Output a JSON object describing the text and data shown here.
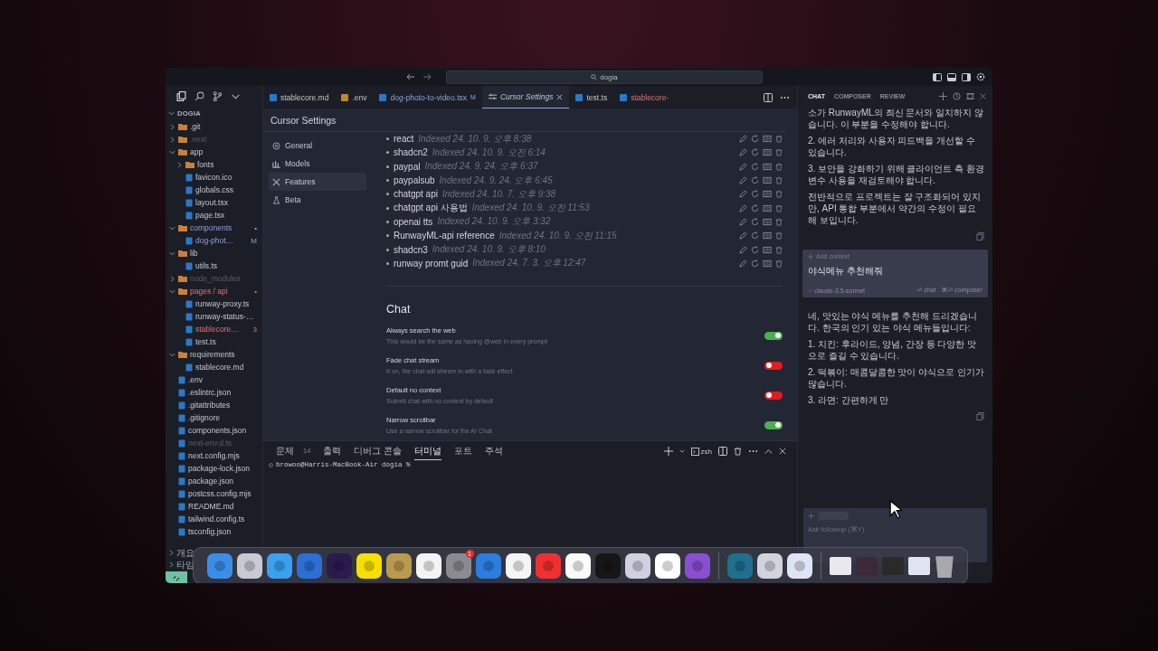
{
  "window": {
    "search": "dogia"
  },
  "explorer": {
    "root": "DOGIA",
    "tree": [
      {
        "name": ".git",
        "kind": "folder",
        "expanded": false,
        "ignored": false,
        "modified": false,
        "error": false
      },
      {
        "name": ".next",
        "kind": "folder",
        "expanded": false,
        "ignored": true,
        "modified": false,
        "error": false
      },
      {
        "name": "app",
        "kind": "folder",
        "expanded": true,
        "ignored": false,
        "modified": false,
        "error": false,
        "children": [
          {
            "name": "fonts",
            "kind": "folder",
            "expanded": false,
            "ignored": false,
            "modified": false,
            "error": false
          },
          {
            "name": "favicon.ico",
            "kind": "file",
            "ignored": false,
            "modified": false,
            "error": false
          },
          {
            "name": "globals.css",
            "kind": "file",
            "ignored": false,
            "modified": false,
            "error": false
          },
          {
            "name": "layout.tsx",
            "kind": "file",
            "ignored": false,
            "modified": false,
            "error": false
          },
          {
            "name": "page.tsx",
            "kind": "file",
            "ignored": false,
            "modified": false,
            "error": false
          }
        ]
      },
      {
        "name": "components",
        "kind": "folder",
        "expanded": true,
        "ignored": false,
        "modified": true,
        "error": false,
        "badge": "•",
        "children": [
          {
            "name": "dog-phot…",
            "kind": "file",
            "ignored": false,
            "modified": true,
            "error": false,
            "badge": "M"
          }
        ]
      },
      {
        "name": "lib",
        "kind": "folder",
        "expanded": true,
        "ignored": false,
        "modified": false,
        "error": false,
        "children": [
          {
            "name": "utils.ts",
            "kind": "file",
            "ignored": false,
            "modified": false,
            "error": false
          }
        ]
      },
      {
        "name": "node_modules",
        "kind": "folder",
        "expanded": false,
        "ignored": true,
        "modified": false,
        "error": false
      },
      {
        "name": "pages / api",
        "kind": "folder",
        "expanded": true,
        "ignored": false,
        "modified": false,
        "error": true,
        "badge": "•",
        "children": [
          {
            "name": "runway-proxy.ts",
            "kind": "file",
            "ignored": false,
            "modified": false,
            "error": false
          },
          {
            "name": "runway-status-…",
            "kind": "file",
            "ignored": false,
            "modified": false,
            "error": false
          },
          {
            "name": "stablecore…",
            "kind": "file",
            "ignored": false,
            "modified": false,
            "error": true,
            "badge": "3"
          },
          {
            "name": "test.ts",
            "kind": "file",
            "ignored": false,
            "modified": false,
            "error": false
          }
        ]
      },
      {
        "name": "requirements",
        "kind": "folder",
        "expanded": true,
        "ignored": false,
        "modified": false,
        "error": false,
        "children": [
          {
            "name": "stablecore.md",
            "kind": "file",
            "ignored": false,
            "modified": false,
            "error": false
          }
        ]
      },
      {
        "name": ".env",
        "kind": "file",
        "ignored": false,
        "modified": false,
        "error": false
      },
      {
        "name": ".eslintrc.json",
        "kind": "file",
        "ignored": false,
        "modified": false,
        "error": false
      },
      {
        "name": ".gitattributes",
        "kind": "file",
        "ignored": false,
        "modified": false,
        "error": false
      },
      {
        "name": ".gitignore",
        "kind": "file",
        "ignored": false,
        "modified": false,
        "error": false
      },
      {
        "name": "components.json",
        "kind": "file",
        "ignored": false,
        "modified": false,
        "error": false
      },
      {
        "name": "next-env.d.ts",
        "kind": "file",
        "ignored": true,
        "modified": false,
        "error": false
      },
      {
        "name": "next.config.mjs",
        "kind": "file",
        "ignored": false,
        "modified": false,
        "error": false
      },
      {
        "name": "package-lock.json",
        "kind": "file",
        "ignored": false,
        "modified": false,
        "error": false
      },
      {
        "name": "package.json",
        "kind": "file",
        "ignored": false,
        "modified": false,
        "error": false
      },
      {
        "name": "postcss.config.mjs",
        "kind": "file",
        "ignored": false,
        "modified": false,
        "error": false
      },
      {
        "name": "README.md",
        "kind": "file",
        "ignored": false,
        "modified": false,
        "error": false
      },
      {
        "name": "tailwind.config.ts",
        "kind": "file",
        "ignored": false,
        "modified": false,
        "error": false
      },
      {
        "name": "tsconfig.json",
        "kind": "file",
        "ignored": false,
        "modified": false,
        "error": false
      }
    ],
    "sections": [
      {
        "label": "개요",
        "expanded": false
      },
      {
        "label": "타임",
        "expanded": false
      }
    ]
  },
  "tabs": [
    {
      "label": "stablecore.md",
      "selected": false,
      "modified": false,
      "error": false
    },
    {
      "label": ".env",
      "selected": false,
      "modified": false,
      "error": false
    },
    {
      "label": "dog-photo-to-video.tsx",
      "selected": false,
      "modified": true,
      "error": false,
      "badge": "M"
    },
    {
      "label": "Cursor Settings",
      "selected": true,
      "modified": false,
      "error": false
    },
    {
      "label": "test.ts",
      "selected": false,
      "modified": false,
      "error": false
    },
    {
      "label": "stablecore-",
      "selected": false,
      "modified": false,
      "error": true
    }
  ],
  "settings": {
    "title": "Cursor Settings",
    "nav": [
      {
        "label": "General",
        "selected": false
      },
      {
        "label": "Models",
        "selected": false
      },
      {
        "label": "Features",
        "selected": true
      },
      {
        "label": "Beta",
        "selected": false
      }
    ],
    "docs": [
      {
        "name": "react",
        "indexed": "Indexed 24. 10. 9. 오후 8:38"
      },
      {
        "name": "shadcn2",
        "indexed": "Indexed 24. 10. 9. 오전 6:14"
      },
      {
        "name": "paypal",
        "indexed": "Indexed 24. 9. 24. 오후 6:37"
      },
      {
        "name": "paypalsub",
        "indexed": "Indexed 24. 9. 24. 오후 6:45"
      },
      {
        "name": "chatgpt api",
        "indexed": "Indexed 24. 10. 7. 오후 9:38"
      },
      {
        "name": "chatgpt api 사용법",
        "indexed": "Indexed 24. 10. 9. 오전 11:53"
      },
      {
        "name": "openai tts",
        "indexed": "Indexed 24. 10. 9. 오후 3:32"
      },
      {
        "name": "RunwayML-api reference",
        "indexed": "Indexed 24. 10. 9. 오전 11:15"
      },
      {
        "name": "shadcn3",
        "indexed": "Indexed 24. 10. 9. 오후 8:10"
      },
      {
        "name": "runway promt guid",
        "indexed": "Indexed 24. 7. 3. 오후 12:47"
      }
    ],
    "chat": {
      "heading": "Chat",
      "toggles": [
        {
          "label": "Always search the web",
          "description": "This would be the same as having @web in every prompt",
          "on": true
        },
        {
          "label": "Fade chat stream",
          "description": "If on, the chat will stream in with a fade effect",
          "on": false
        },
        {
          "label": "Default no context",
          "description": "Submit chat with no context by default",
          "on": false
        },
        {
          "label": "Narrow scrollbar",
          "description": "Use a narrow scrollbar for the AI Chat",
          "on": true
        }
      ]
    }
  },
  "panel": {
    "tabs": [
      {
        "label": "문제",
        "count": "14",
        "selected": false
      },
      {
        "label": "출력",
        "selected": false
      },
      {
        "label": "디버그 콘솔",
        "selected": false
      },
      {
        "label": "터미널",
        "selected": true
      },
      {
        "label": "포트",
        "selected": false
      },
      {
        "label": "주석",
        "selected": false
      }
    ],
    "shell": "zsh",
    "prompt": "browoo@Harris-MacBook-Air dogia %"
  },
  "chat": {
    "tabs": [
      {
        "label": "CHAT",
        "selected": true
      },
      {
        "label": "COMPOSER",
        "selected": false
      },
      {
        "label": "REVIEW",
        "selected": false
      }
    ],
    "history": [
      "소가 RunwayML의 최신 문서와 일치하지 않습니다. 이 부분을 수정해야 합니다.",
      "2. 에러 처리와 사용자 피드백을 개선할 수 있습니다.",
      "3. 보안을 강화하기 위해 클라이언트 측 환경 변수 사용을 재검토해야 합니다.",
      "전반적으로 프로젝트는 잘 구조화되어 있지만, API 통합 부분에서 약간의 수정이 필요해 보입니다."
    ],
    "prompt": {
      "context": "Add context",
      "text": "야식메뉴 추천해줘",
      "model": "claude-3.5-sonnet",
      "chat_hint": "⏎ chat",
      "composer_hint": "⌘⏎ composer"
    },
    "reply": [
      "네, 맛있는 야식 메뉴를 추천해 드리겠습니다. 한국의 인기 있는 야식 메뉴들입니다:",
      "1. 치킨: 후라이드, 양념, 간장 등 다양한 맛으로 즐길 수 있습니다.",
      "2. 떡볶이: 매콤달콤한 맛이 야식으로 인기가 많습니다.",
      "3. 라면: 간편하게 만"
    ],
    "input": {
      "placeholder": "Ask followup (⌘Y)"
    }
  },
  "dock": [
    {
      "kind": "app",
      "color": "#3b8ee8"
    },
    {
      "kind": "app",
      "color": "#c9c9d2"
    },
    {
      "kind": "app",
      "color": "#3aa0f0"
    },
    {
      "kind": "app",
      "color": "#2a6fd6"
    },
    {
      "kind": "app",
      "color": "#2a1a50"
    },
    {
      "kind": "app",
      "color": "#f7e000"
    },
    {
      "kind": "app",
      "color": "#b99a4e"
    },
    {
      "kind": "app",
      "color": "#f4f4f4"
    },
    {
      "kind": "app",
      "color": "#8a8a90",
      "badge": "1"
    },
    {
      "kind": "app",
      "color": "#2b7de0"
    },
    {
      "kind": "app",
      "color": "#f5f5f5"
    },
    {
      "kind": "app",
      "color": "#f03030"
    },
    {
      "kind": "app",
      "color": "#fafafa"
    },
    {
      "kind": "app",
      "color": "#161616"
    },
    {
      "kind": "app",
      "color": "#d0d0e0"
    },
    {
      "kind": "app",
      "color": "#ffffff"
    },
    {
      "kind": "app",
      "color": "#8a4fd0"
    },
    {
      "kind": "separator"
    },
    {
      "kind": "app",
      "color": "#1f6f8f"
    },
    {
      "kind": "app",
      "color": "#d0d4dc"
    },
    {
      "kind": "app",
      "color": "#dfe4f4"
    },
    {
      "kind": "separator"
    },
    {
      "kind": "window",
      "color": "#e8e8ee"
    },
    {
      "kind": "window",
      "color": "#3a2a3a"
    },
    {
      "kind": "window",
      "color": "#2a2a2a"
    },
    {
      "kind": "window",
      "color": "#e0e4f0"
    },
    {
      "kind": "trash",
      "color": "#a8a8ae"
    }
  ]
}
